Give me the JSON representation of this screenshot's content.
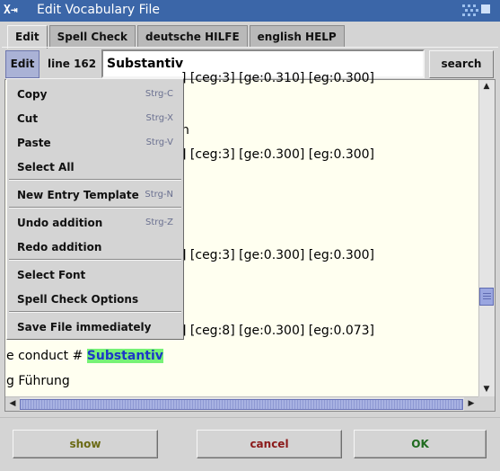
{
  "window": {
    "title": "Edit Vocabulary File"
  },
  "tabs": [
    {
      "label": "Edit"
    },
    {
      "label": "Spell Check"
    },
    {
      "label": "deutsche HILFE"
    },
    {
      "label": "english HELP"
    }
  ],
  "toolbar": {
    "edit_label": "Edit",
    "line_label": "line 162",
    "search_value": "Substantiv",
    "search_label": "search"
  },
  "editor": {
    "lines": [
      "] [ceg:3] [ge:0.300] [eg:0.300]",
      "] [ceg:3] [ge:0.300] [eg:0.300]",
      "] [ceg:8] [ge:0.300] [eg:0.073]",
      "e conduct # ",
      "g Führung"
    ],
    "highlight": "Substantiv",
    "top_partial": "] [ceg:3] [ge:0.310] [eg:0.300]",
    "small_char": "n"
  },
  "menu": {
    "items": [
      {
        "label": "Copy",
        "shortcut": "Strg-C"
      },
      {
        "label": "Cut",
        "shortcut": "Strg-X"
      },
      {
        "label": "Paste",
        "shortcut": "Strg-V"
      },
      {
        "label": "Select All",
        "shortcut": ""
      },
      {
        "label": "New Entry Template",
        "shortcut": "Strg-N"
      },
      {
        "label": "Undo addition",
        "shortcut": "Strg-Z"
      },
      {
        "label": "Redo addition",
        "shortcut": ""
      },
      {
        "label": "Select Font",
        "shortcut": ""
      },
      {
        "label": "Spell Check Options",
        "shortcut": ""
      },
      {
        "label": "Save File immediately",
        "shortcut": ""
      }
    ]
  },
  "buttons": {
    "show": "show",
    "cancel": "cancel",
    "ok": "OK"
  },
  "colors": {
    "titlebar": "#3b66a8",
    "editor_bg": "#fffff0",
    "highlight_bg": "#77f277",
    "highlight_fg": "#1d37c8",
    "show": "#6b6a14",
    "cancel": "#8b1a1a",
    "ok": "#1f6b1f"
  },
  "icons": [
    "window-menu-icon",
    "window-controls-icon",
    "scroll-left-arrow-icon",
    "scroll-right-arrow-icon",
    "scroll-up-arrow-icon",
    "scroll-down-arrow-icon"
  ]
}
